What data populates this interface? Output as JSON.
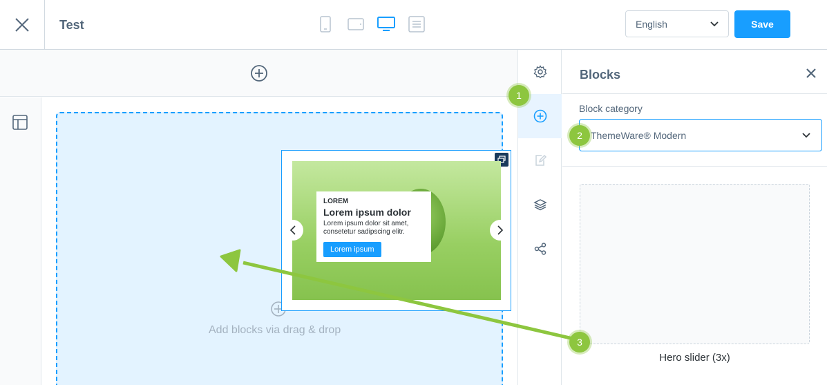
{
  "header": {
    "title": "Test",
    "language": "English",
    "save_label": "Save",
    "devices": [
      "mobile-icon",
      "tablet-icon",
      "desktop-icon",
      "list-icon"
    ],
    "active_device": "desktop-icon"
  },
  "canvas": {
    "dropzone_text": "Add blocks via drag & drop"
  },
  "preview": {
    "kicker": "LOREM",
    "title": "Lorem ipsum dolor",
    "text": "Lorem ipsum dolor sit amet, consetetur sadipscing elitr.",
    "button": "Lorem ipsum"
  },
  "sidebar": {
    "items": [
      "gear-icon",
      "plus-circle-icon",
      "edit-icon",
      "layers-icon",
      "share-icon"
    ],
    "active": "plus-circle-icon"
  },
  "blocks_panel": {
    "title": "Blocks",
    "category_label": "Block category",
    "category_value": "ThemeWare® Modern",
    "block_name": "Hero slider (3x)"
  },
  "callouts": [
    "1",
    "2",
    "3"
  ],
  "colors": {
    "accent": "#189eff",
    "callout": "#8dc63f",
    "text": "#52667a",
    "dropzone_bg": "#e3f3ff"
  }
}
